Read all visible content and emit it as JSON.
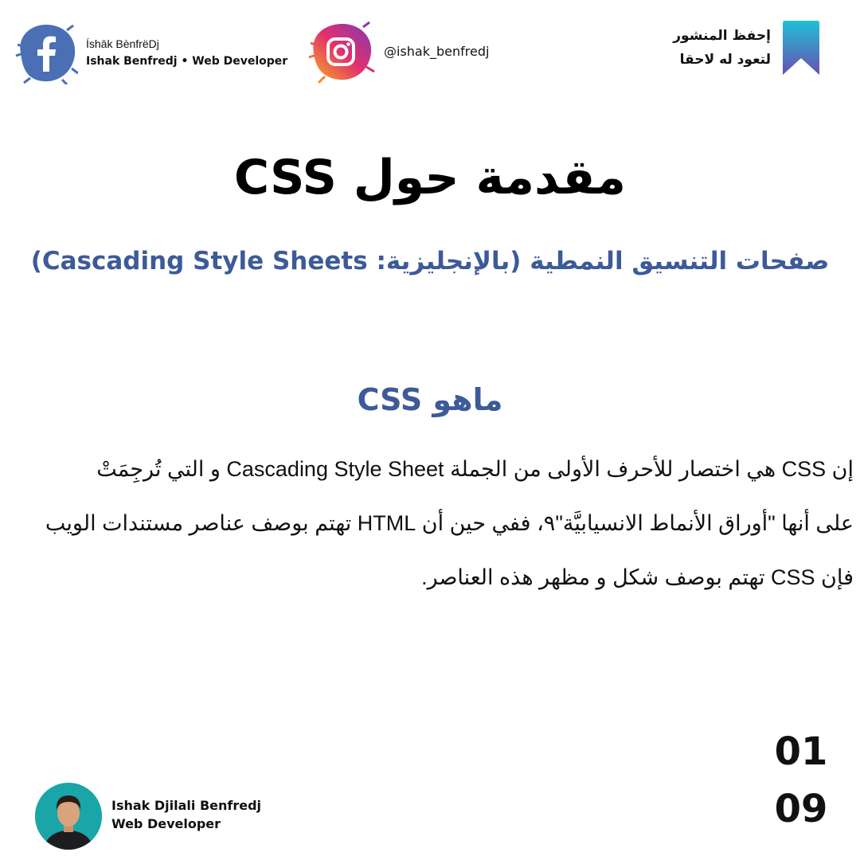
{
  "header": {
    "facebook": {
      "icon": "facebook-icon",
      "name": "Íshāk BènfrëDj",
      "role": "Ishak Benfredj • Web Developer",
      "brush_color": "#4a6fb5"
    },
    "instagram": {
      "icon": "instagram-icon",
      "handle": "@ishak_benfredj",
      "gradient": [
        "#f9a826",
        "#e1306c",
        "#833ab4"
      ]
    },
    "save_post": {
      "icon": "bookmark-icon",
      "line1": "إحفظ المنشور",
      "line2": "لتعود له لاحقا",
      "gradient": [
        "#1ec1d6",
        "#6a4fb0"
      ]
    }
  },
  "title": "مقدمة حول CSS",
  "subtitle": "صفحات التنسيق النمطية (بالإنجليزية: Cascading Style Sheets)",
  "section": {
    "heading": "ماهو CSS",
    "lines": [
      "إن CSS هي اختصار للأحرف الأولى من الجملة Cascading Style Sheet و التي تُرجِمَتْ",
      "على أنها \"أوراق الأنماط الانسيابيَّة\"٩، ففي حين أن HTML تهتم بوصف عناصر مستندات الويب",
      "فإن CSS تهتم بوصف شكل و مظهر هذه العناصر."
    ]
  },
  "footer": {
    "author_name": "Ishak Djilali Benfredj",
    "author_role": "Web Developer",
    "page_current": "01",
    "page_total": "09"
  },
  "colors": {
    "accent": "#3d5a99",
    "text": "#111111"
  }
}
